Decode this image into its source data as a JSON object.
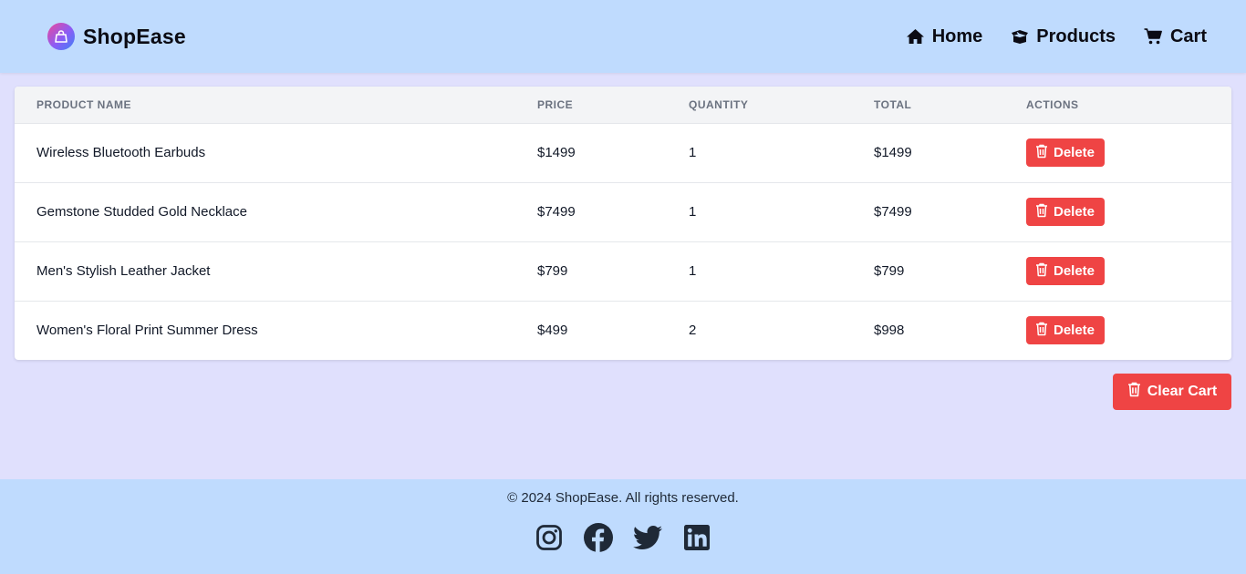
{
  "header": {
    "brand": "ShopEase",
    "nav": [
      {
        "label": "Home",
        "icon": "home-icon"
      },
      {
        "label": "Products",
        "icon": "box-icon"
      },
      {
        "label": "Cart",
        "icon": "cart-icon"
      }
    ]
  },
  "table": {
    "columns": [
      "PRODUCT NAME",
      "PRICE",
      "QUANTITY",
      "TOTAL",
      "ACTIONS"
    ],
    "rows": [
      {
        "name": "Wireless Bluetooth Earbuds",
        "price": "$1499",
        "quantity": "1",
        "total": "$1499",
        "action": "Delete"
      },
      {
        "name": "Gemstone Studded Gold Necklace",
        "price": "$7499",
        "quantity": "1",
        "total": "$7499",
        "action": "Delete"
      },
      {
        "name": "Men's Stylish Leather Jacket",
        "price": "$799",
        "quantity": "1",
        "total": "$799",
        "action": "Delete"
      },
      {
        "name": "Women's Floral Print Summer Dress",
        "price": "$499",
        "quantity": "2",
        "total": "$998",
        "action": "Delete"
      }
    ]
  },
  "clear_cart_label": "Clear Cart",
  "footer": {
    "copyright": "© 2024 ShopEase. All rights reserved.",
    "socials": [
      "instagram-icon",
      "facebook-icon",
      "twitter-icon",
      "linkedin-icon"
    ]
  },
  "colors": {
    "header_bg": "#bfdbfe",
    "page_bg": "#e0e0fd",
    "danger": "#ef4444"
  }
}
